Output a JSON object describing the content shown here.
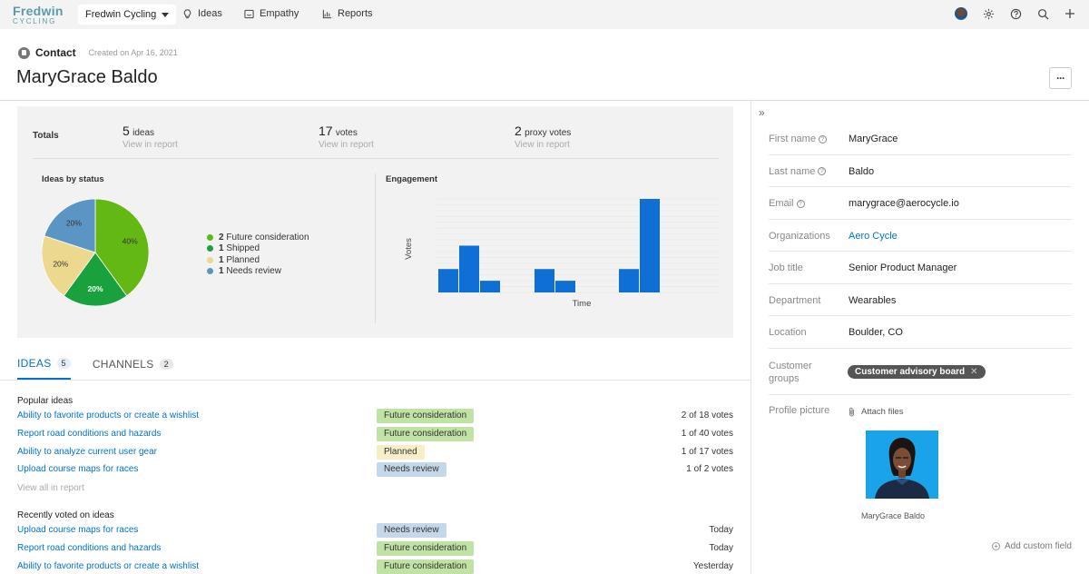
{
  "topnav": {
    "logo_line1": "Fredwin",
    "logo_line2": "CYCLING",
    "workspace": "Fredwin Cycling",
    "links": {
      "ideas": "Ideas",
      "empathy": "Empathy",
      "reports": "Reports"
    },
    "icons": [
      "avatar",
      "gear-icon",
      "help-icon",
      "search-icon",
      "plus-icon"
    ]
  },
  "header": {
    "record_type": "Contact",
    "created": "Created on Apr 16, 2021",
    "title": "MaryGrace Baldo",
    "more": "···"
  },
  "totals": {
    "label": "Totals",
    "items": [
      {
        "num": "5",
        "unit": "ideas",
        "link": "View in report"
      },
      {
        "num": "17",
        "unit": "votes",
        "link": "View in report"
      },
      {
        "num": "2",
        "unit": "proxy votes",
        "link": "View in report"
      }
    ]
  },
  "status_chart": {
    "title": "Ideas by status",
    "slices": [
      {
        "pct": 40,
        "label": "40%",
        "color": "#64b813"
      },
      {
        "pct": 20,
        "label": "20%",
        "color": "#18a13d"
      },
      {
        "pct": 20,
        "label": "20%",
        "color": "#ecd98e"
      },
      {
        "pct": 20,
        "label": "20%",
        "color": "#5b95c4"
      }
    ],
    "legend": [
      {
        "count": "2",
        "label": "Future consideration",
        "color": "#64b813"
      },
      {
        "count": "1",
        "label": "Shipped",
        "color": "#18a13d"
      },
      {
        "count": "1",
        "label": "Planned",
        "color": "#ecd98e"
      },
      {
        "count": "1",
        "label": "Needs review",
        "color": "#5b95c4"
      }
    ]
  },
  "chart_data": {
    "type": "bar",
    "title": "Engagement",
    "xlabel": "Time",
    "ylabel": "Votes",
    "values": [
      2,
      4,
      1,
      0,
      2,
      1,
      0,
      2,
      8
    ],
    "ylim": [
      0,
      8
    ],
    "color": "#0f6fd4",
    "grid": true
  },
  "tabs": [
    {
      "label": "IDEAS",
      "count": "5",
      "active": true
    },
    {
      "label": "CHANNELS",
      "count": "2",
      "active": false
    }
  ],
  "popular": {
    "title": "Popular ideas",
    "rows": [
      {
        "name": "Ability to favorite products or create a wishlist",
        "status": "Future consideration",
        "status_color": "#c0e2a4",
        "votes": "2 of 18 votes"
      },
      {
        "name": "Report road conditions and hazards",
        "status": "Future consideration",
        "status_color": "#c0e2a4",
        "votes": "1 of 40 votes"
      },
      {
        "name": "Ability to analyze current user gear",
        "status": "Planned",
        "status_color": "#f7eec7",
        "votes": "1 of 17 votes"
      },
      {
        "name": "Upload course maps for races",
        "status": "Needs review",
        "status_color": "#c5d8ea",
        "votes": "1 of 2 votes"
      }
    ],
    "view_all": "View all in report"
  },
  "recent": {
    "title": "Recently voted on ideas",
    "rows": [
      {
        "name": "Upload course maps for races",
        "status": "Needs review",
        "status_color": "#c5d8ea",
        "votes": "Today"
      },
      {
        "name": "Report road conditions and hazards",
        "status": "Future consideration",
        "status_color": "#c0e2a4",
        "votes": "Today"
      },
      {
        "name": "Ability to favorite products or create a wishlist",
        "status": "Future consideration",
        "status_color": "#c0e2a4",
        "votes": "Yesterday"
      }
    ]
  },
  "sidebar": {
    "fields": [
      {
        "label": "First name",
        "help": true,
        "value": "MaryGrace",
        "link": false
      },
      {
        "label": "Last name",
        "help": true,
        "value": "Baldo",
        "link": false
      },
      {
        "label": "Email",
        "help": true,
        "value": "marygrace@aerocycle.io",
        "link": false
      },
      {
        "label": "Organizations",
        "help": false,
        "value": "Aero Cycle",
        "link": true
      },
      {
        "label": "Job title",
        "help": false,
        "value": "Senior Product Manager",
        "link": false
      },
      {
        "label": "Department",
        "help": false,
        "value": "Wearables",
        "link": false
      },
      {
        "label": "Location",
        "help": false,
        "value": "Boulder, CO",
        "link": false
      }
    ],
    "customer_groups_label_1": "Customer",
    "customer_groups_label_2": "groups",
    "customer_group_chip": "Customer advisory board",
    "profile_picture_label": "Profile picture",
    "attach_files": "Attach files",
    "photo_caption": "MaryGrace Baldo",
    "add_custom_field": "Add custom field"
  }
}
